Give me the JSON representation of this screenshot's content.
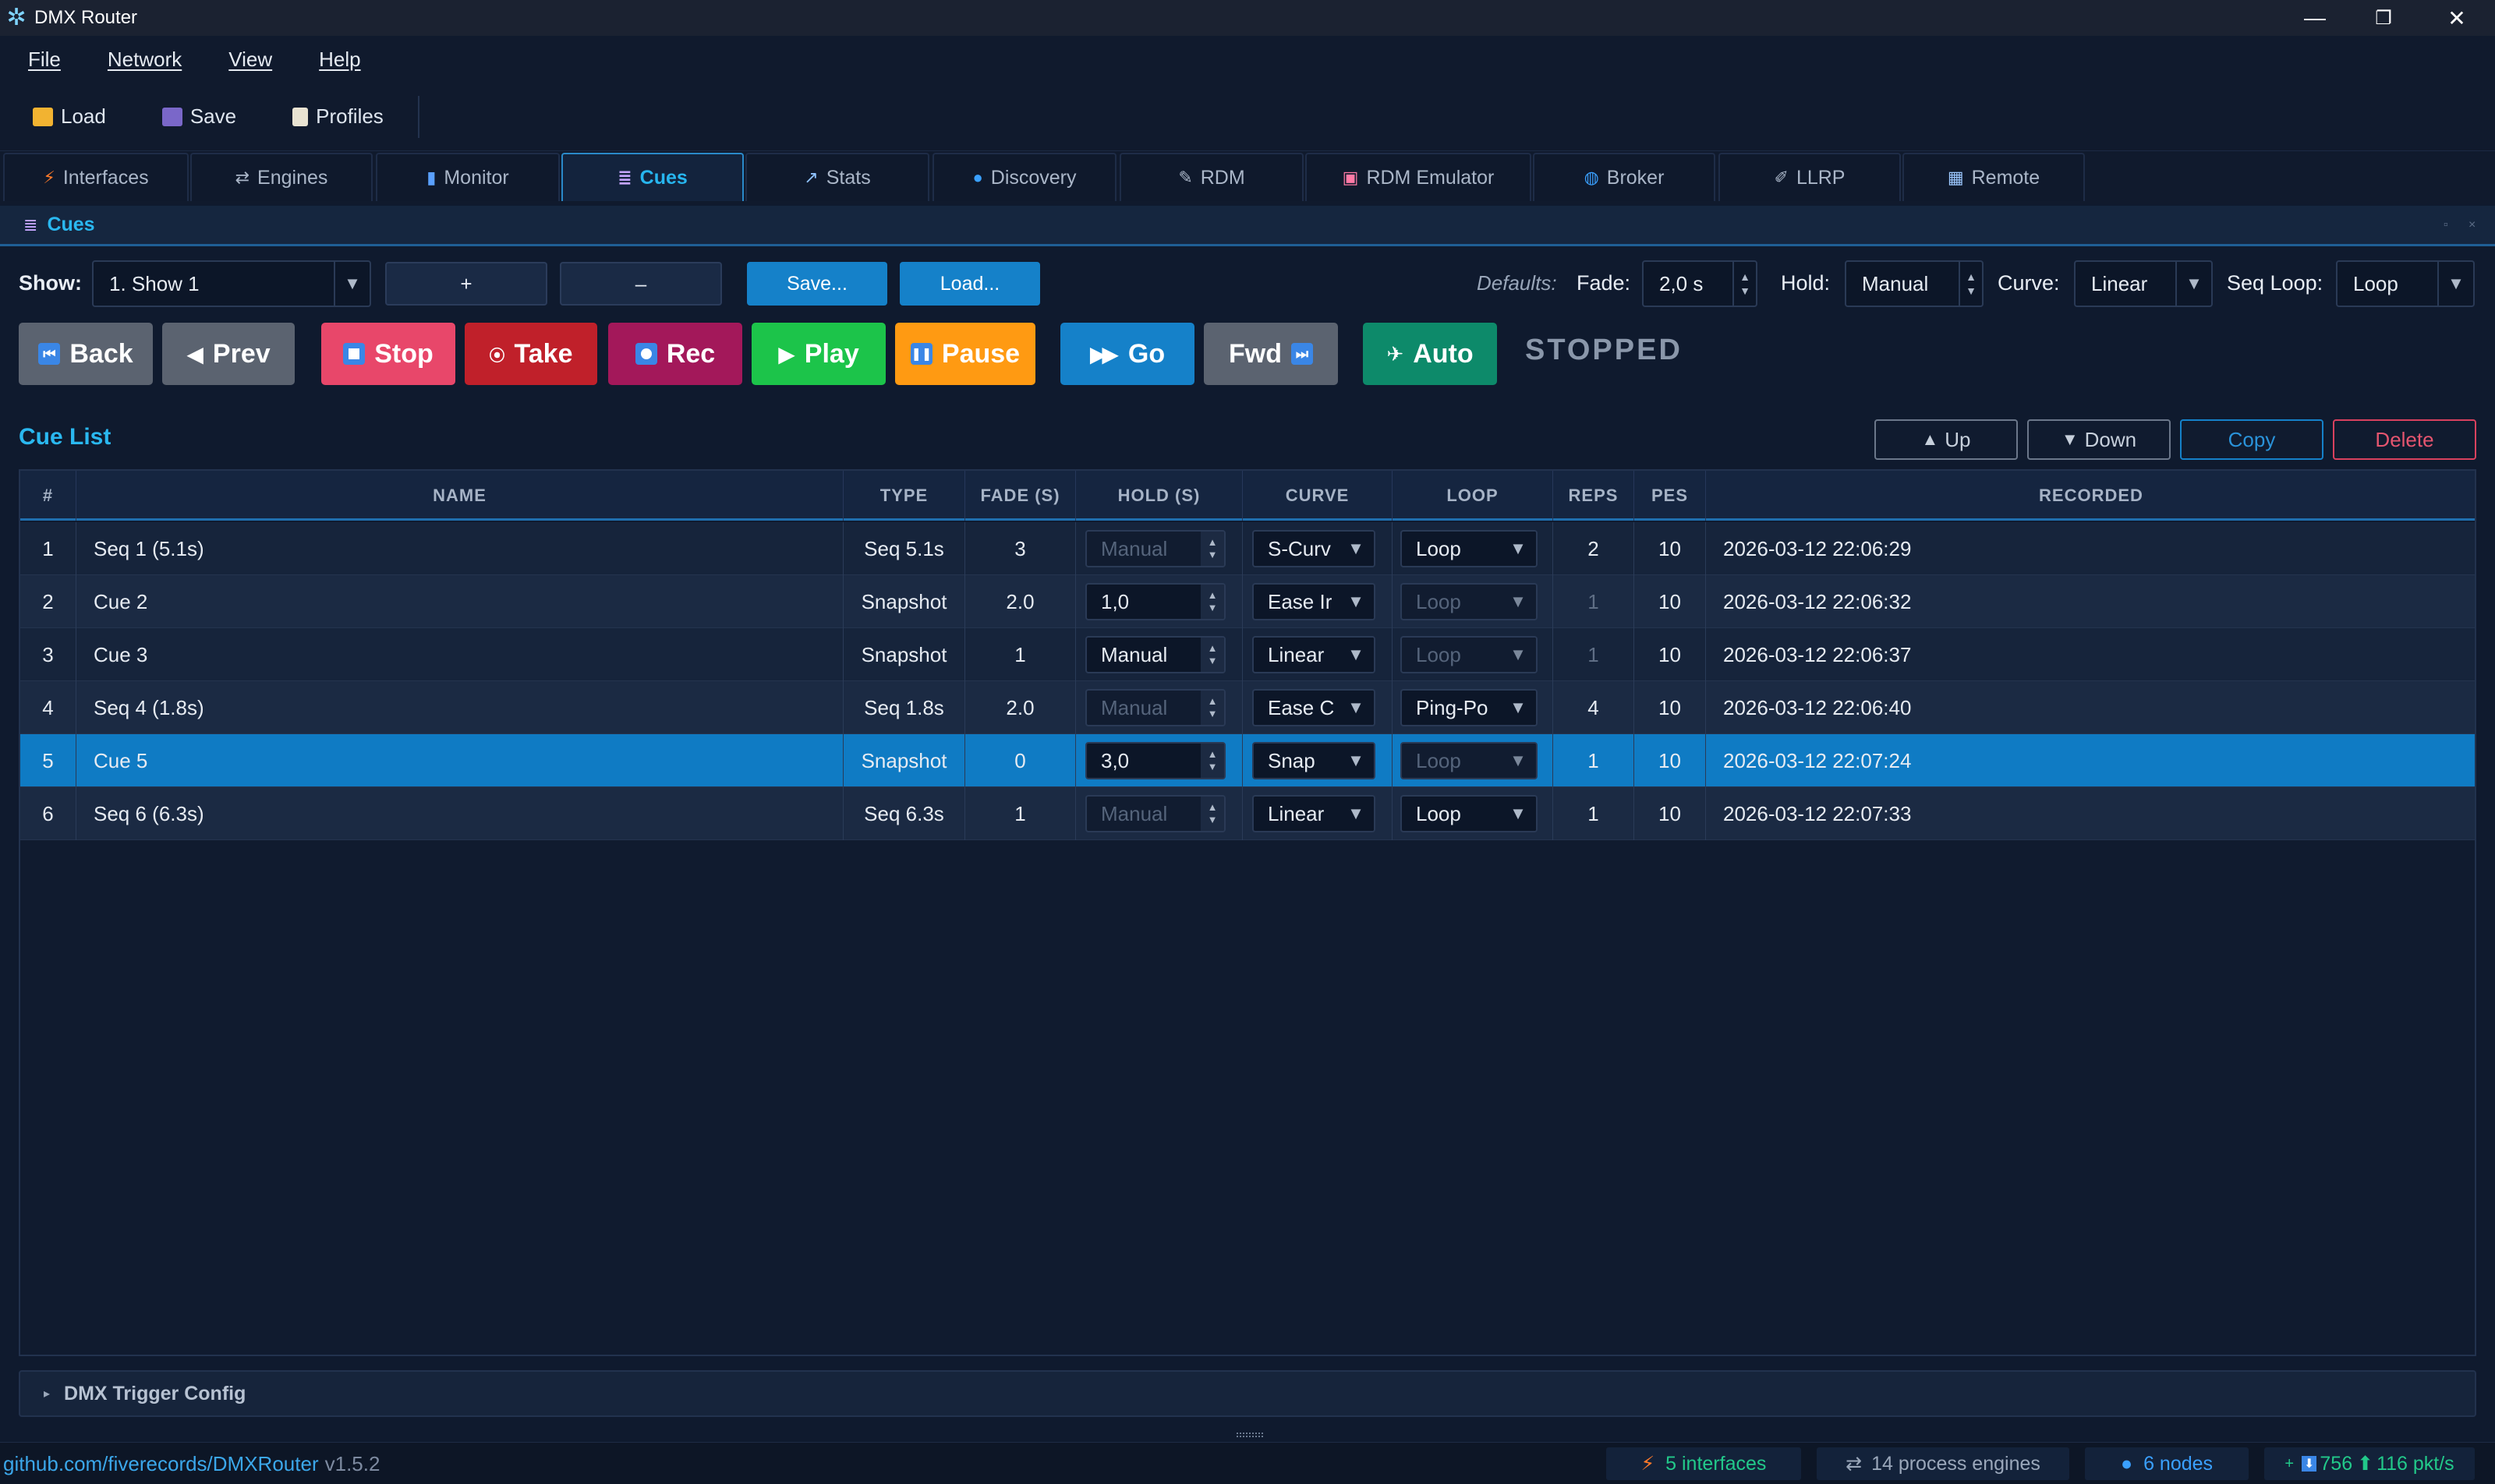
{
  "window": {
    "title": "DMX Router",
    "controls": {
      "minimize": "—",
      "restore": "❐",
      "close": "✕"
    }
  },
  "menu": [
    "File",
    "Network",
    "View",
    "Help"
  ],
  "toolbar": {
    "load": "Load",
    "save": "Save",
    "profiles": "Profiles"
  },
  "tabs": [
    {
      "label": "Interfaces",
      "icon": "⚡"
    },
    {
      "label": "Engines",
      "icon": "⇄"
    },
    {
      "label": "Monitor",
      "icon": "▮"
    },
    {
      "label": "Cues",
      "icon": "≣"
    },
    {
      "label": "Stats",
      "icon": "↗"
    },
    {
      "label": "Discovery",
      "icon": "●"
    },
    {
      "label": "RDM",
      "icon": "✎"
    },
    {
      "label": "RDM Emulator",
      "icon": "▣"
    },
    {
      "label": "Broker",
      "icon": "◍"
    },
    {
      "label": "LLRP",
      "icon": "✐"
    },
    {
      "label": "Remote",
      "icon": "▦"
    }
  ],
  "active_tab": "Cues",
  "panel": {
    "title": "Cues"
  },
  "show": {
    "label": "Show:",
    "selected": "1. Show 1",
    "add": "+",
    "remove": "–",
    "save": "Save...",
    "load": "Load..."
  },
  "defaults": {
    "label": "Defaults:",
    "fade_label": "Fade:",
    "fade_value": "2,0 s",
    "hold_label": "Hold:",
    "hold_value": "Manual",
    "curve_label": "Curve:",
    "curve_value": "Linear",
    "seqloop_label": "Seq Loop:",
    "seqloop_value": "Loop"
  },
  "transport": {
    "back": "Back",
    "prev": "Prev",
    "stop": "Stop",
    "take": "Take",
    "rec": "Rec",
    "play": "Play",
    "pause": "Pause",
    "go": "Go",
    "fwd": "Fwd",
    "auto": "Auto",
    "status": "STOPPED",
    "colors": {
      "back": "#5b6370",
      "prev": "#5b6370",
      "stop": "#e8476a",
      "take": "#c0202a",
      "rec": "#a3185a",
      "play": "#1cc44a",
      "pause": "#ff9a12",
      "go": "#1581c9",
      "fwd": "#5b6370",
      "auto": "#0d8a6a"
    }
  },
  "cue_list": {
    "title": "Cue List",
    "up": "Up",
    "down": "Down",
    "copy": "Copy",
    "delete": "Delete",
    "columns": [
      "#",
      "NAME",
      "TYPE",
      "FADE (S)",
      "HOLD (S)",
      "CURVE",
      "LOOP",
      "REPS",
      "PES",
      "RECORDED"
    ],
    "rows": [
      {
        "num": "1",
        "name": "Seq 1 (5.1s)",
        "type": "Seq 5.1s",
        "fade": "3",
        "hold": "Manual",
        "hold_enabled": false,
        "curve": "S-Curv",
        "loop": "Loop",
        "loop_enabled": true,
        "reps": "2",
        "reps_enabled": true,
        "pes": "10",
        "recorded": "2026-03-12 22:06:29"
      },
      {
        "num": "2",
        "name": "Cue 2",
        "type": "Snapshot",
        "fade": "2.0",
        "hold": "1,0",
        "hold_enabled": true,
        "curve": "Ease Ir",
        "loop": "Loop",
        "loop_enabled": false,
        "reps": "1",
        "reps_enabled": false,
        "pes": "10",
        "recorded": "2026-03-12 22:06:32"
      },
      {
        "num": "3",
        "name": "Cue 3",
        "type": "Snapshot",
        "fade": "1",
        "hold": "Manual",
        "hold_enabled": true,
        "curve": "Linear",
        "loop": "Loop",
        "loop_enabled": false,
        "reps": "1",
        "reps_enabled": false,
        "pes": "10",
        "recorded": "2026-03-12 22:06:37"
      },
      {
        "num": "4",
        "name": "Seq 4 (1.8s)",
        "type": "Seq 1.8s",
        "fade": "2.0",
        "hold": "Manual",
        "hold_enabled": false,
        "curve": "Ease C",
        "loop": "Ping-Po",
        "loop_enabled": true,
        "reps": "4",
        "reps_enabled": true,
        "pes": "10",
        "recorded": "2026-03-12 22:06:40"
      },
      {
        "num": "5",
        "name": "Cue 5",
        "type": "Snapshot",
        "fade": "0",
        "hold": "3,0",
        "hold_enabled": true,
        "curve": "Snap",
        "loop": "Loop",
        "loop_enabled": false,
        "reps": "1",
        "reps_enabled": true,
        "pes": "10",
        "recorded": "2026-03-12 22:07:24",
        "selected": true
      },
      {
        "num": "6",
        "name": "Seq 6 (6.3s)",
        "type": "Seq 6.3s",
        "fade": "1",
        "hold": "Manual",
        "hold_enabled": false,
        "curve": "Linear",
        "loop": "Loop",
        "loop_enabled": true,
        "reps": "1",
        "reps_enabled": true,
        "pes": "10",
        "recorded": "2026-03-12 22:07:33"
      }
    ]
  },
  "trigger": {
    "label": "DMX Trigger Config"
  },
  "statusbar": {
    "link": "github.com/fiverecords/DMXRouter",
    "version": "v1.5.2",
    "interfaces": "5 interfaces",
    "engines": "14 process engines",
    "nodes": "6 nodes",
    "pkt_in": "756",
    "pkt_out": "116 pkt/s"
  }
}
